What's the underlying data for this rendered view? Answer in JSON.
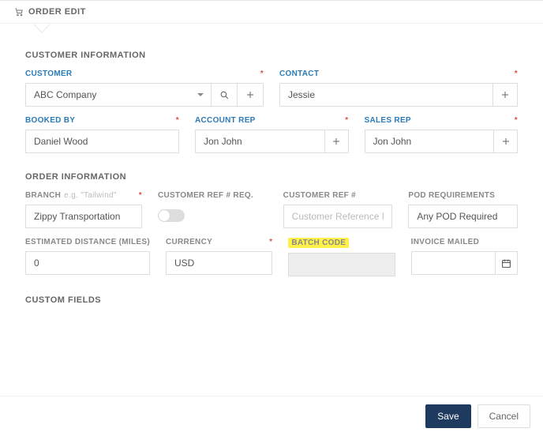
{
  "header": {
    "title": "ORDER EDIT"
  },
  "sections": {
    "customer_info": "CUSTOMER INFORMATION",
    "order_info": "ORDER INFORMATION",
    "custom_fields": "CUSTOM FIELDS"
  },
  "customer": {
    "label": "CUSTOMER",
    "value": "ABC Company",
    "contact_label": "CONTACT",
    "contact_value": "Jessie",
    "booked_by_label": "BOOKED BY",
    "booked_by_value": "Daniel Wood",
    "account_rep_label": "ACCOUNT REP",
    "account_rep_value": "Jon John",
    "sales_rep_label": "SALES REP",
    "sales_rep_value": "Jon John"
  },
  "order": {
    "branch_label": "BRANCH",
    "branch_hint": "e.g. \"Tailwind\"",
    "branch_value": "Zippy Transportation",
    "cust_ref_req_label": "CUSTOMER REF # REQ.",
    "cust_ref_req_on": false,
    "cust_ref_label": "CUSTOMER REF #",
    "cust_ref_placeholder": "Customer Reference Number",
    "cust_ref_value": "",
    "pod_label": "POD REQUIREMENTS",
    "pod_value": "Any POD Required",
    "est_dist_label": "ESTIMATED DISTANCE (MILES)",
    "est_dist_value": "0",
    "currency_label": "CURRENCY",
    "currency_value": "USD",
    "batch_code_label": "BATCH CODE",
    "batch_code_value": "",
    "invoice_mailed_label": "INVOICE MAILED",
    "invoice_mailed_value": ""
  },
  "footer": {
    "save": "Save",
    "cancel": "Cancel"
  },
  "required_mark": "*"
}
